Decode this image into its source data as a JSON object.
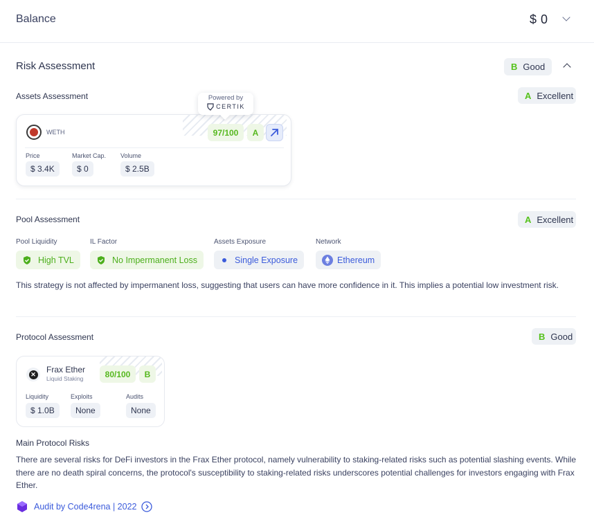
{
  "balance": {
    "title": "Balance",
    "value": "$ 0"
  },
  "risk": {
    "title": "Risk Assessment",
    "overall_grade": "B",
    "overall_label": "Good"
  },
  "assets": {
    "title": "Assets Assessment",
    "grade": "A",
    "grade_label": "Excellent",
    "tooltip_line1": "Powered by",
    "tooltip_brand": "CERTIK",
    "card": {
      "token": "WETH",
      "score": "97/100",
      "grade": "A",
      "metrics": [
        {
          "label": "Price",
          "value": "$ 3.4K"
        },
        {
          "label": "Market Cap.",
          "value": "$ 0"
        },
        {
          "label": "Volume",
          "value": "$ 2.5B"
        }
      ]
    }
  },
  "pool": {
    "title": "Pool Assessment",
    "grade": "A",
    "grade_label": "Excellent",
    "items": [
      {
        "label": "Pool Liquidity",
        "value": "High TVL"
      },
      {
        "label": "IL Factor",
        "value": "No Impermanent Loss"
      },
      {
        "label": "Assets Exposure",
        "value": "Single Exposure"
      },
      {
        "label": "Network",
        "value": "Ethereum"
      }
    ],
    "description": "This strategy is not affected by impermanent loss, suggesting that users can have more confidence in it. This implies a potential low investment risk."
  },
  "protocol": {
    "title": "Protocol Assessment",
    "grade": "B",
    "grade_label": "Good",
    "card": {
      "name": "Frax Ether",
      "category": "Liquid Staking",
      "score": "80/100",
      "grade": "B",
      "metrics": [
        {
          "label": "Liquidity",
          "value": "$ 1.0B"
        },
        {
          "label": "Exploits",
          "value": "None"
        },
        {
          "label": "Audits",
          "value": "None"
        }
      ]
    },
    "risks_title": "Main Protocol Risks",
    "risks_text": "There are several risks for DeFi investors in the Frax Ether protocol, namely vulnerability to staking-related risks such as potential slashing events. While there are no death spiral concerns, the protocol's susceptibility to staking-related risks underscores potential challenges for investors engaging with Frax Ether.",
    "audit_link": "Audit by Code4rena | 2022"
  },
  "colors": {
    "good_green": "#55c21b",
    "link_blue": "#3b5bdb",
    "badge_bg": "#eef1f5"
  },
  "icons": [
    "chevron-down-icon",
    "chevron-up-icon",
    "certik-logo-icon",
    "weth-token-icon",
    "external-link-icon",
    "shield-check-icon",
    "dot-icon",
    "ethereum-icon",
    "frax-ether-icon",
    "code4rena-icon",
    "circle-arrow-right-icon"
  ]
}
